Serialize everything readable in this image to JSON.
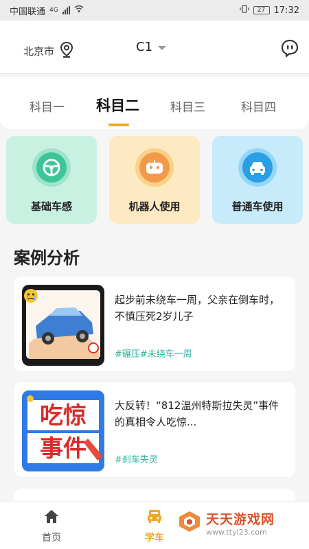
{
  "status_bar": {
    "carrier": "中国联通",
    "network": "4G",
    "battery": "27",
    "time": "17:32"
  },
  "header": {
    "city": "北京市",
    "license": "C1"
  },
  "tabs": [
    {
      "label": "科目一"
    },
    {
      "label": "科目二"
    },
    {
      "label": "科目三"
    },
    {
      "label": "科目四"
    }
  ],
  "active_tab": "科目二",
  "features": [
    {
      "label": "基础车感",
      "icon": "steering-wheel-icon",
      "bg": "#c9f1e2",
      "ring": "#9fe3cb",
      "accent": "#3cc698"
    },
    {
      "label": "机器人使用",
      "icon": "robot-icon",
      "bg": "#fde9c2",
      "ring": "#f8d28a",
      "accent": "#f29a4a"
    },
    {
      "label": "普通车使用",
      "icon": "car-icon",
      "bg": "#c7ebfb",
      "ring": "#95d6f5",
      "accent": "#2a9fe6"
    }
  ],
  "section": {
    "title": "案例分析"
  },
  "cases": [
    {
      "title": "起步前未绕车一周，父亲在倒车时，不慎压死2岁儿子",
      "tags": "#碾压#未绕车一周"
    },
    {
      "title": "大反转！“812温州特斯拉失灵”事件的真相令人吃惊...",
      "tags": "#刹车失灵",
      "thumb_text": [
        "吃惊",
        "事件"
      ]
    }
  ],
  "bottom_nav": [
    {
      "label": "首页",
      "icon": "home-icon"
    },
    {
      "label": "学车",
      "icon": "learn-car-icon"
    }
  ],
  "watermark": {
    "main": "天天游戏网",
    "sub": "www.ttyl23.com"
  },
  "colors": {
    "accent": "#f3a723",
    "tag": "#2bb39c"
  }
}
